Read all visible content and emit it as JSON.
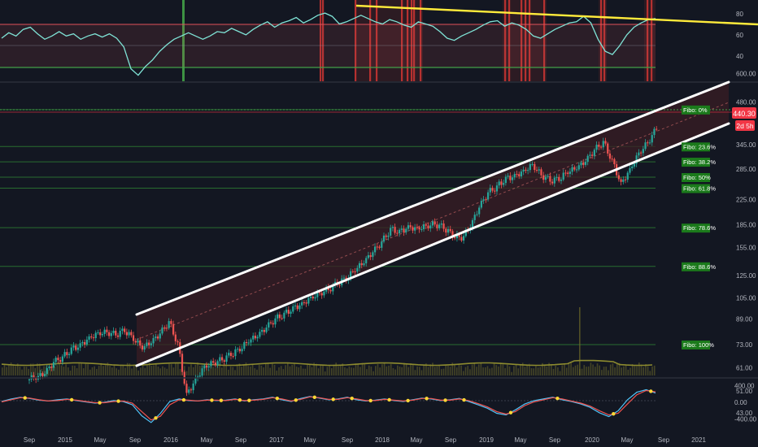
{
  "colors": {
    "background": "#131722",
    "axis_text": "#b2b5be",
    "grid": "#1f2330",
    "channel_line": "#ffffff",
    "channel_fill": "#3a1d24",
    "rsi_line": "#7fe3d6",
    "rsi_band": "#e0525a",
    "rsi_trendline": "#ffeb3b",
    "signal_red": "#e53935",
    "signal_green": "#43a047",
    "fibo_line": "#2e7d32",
    "fibo_label_bg": "#1b7a1b",
    "candle_up": "#26a69a",
    "candle_down": "#ef5350",
    "volume": "#6d6a2a",
    "macd_blue": "#4fc3f7",
    "macd_red": "#ef5350",
    "price_badge": "#f23645"
  },
  "chart_data": [
    {
      "type": "line",
      "panel": "rsi",
      "yticks": [
        "80",
        "60",
        "40"
      ],
      "ylim": [
        20,
        90
      ],
      "overbought": 70,
      "oversold": 30,
      "trendline_from": [
        "2017-09",
        88
      ],
      "trendline_to": [
        "2021-06",
        72
      ],
      "series": [
        {
          "values": [
            58,
            63,
            60,
            66,
            68,
            62,
            57,
            60,
            64,
            60,
            62,
            57,
            60,
            62,
            59,
            62,
            58,
            50,
            30,
            24,
            32,
            38,
            46,
            52,
            57,
            60,
            63,
            60,
            57,
            60,
            64,
            63,
            67,
            64,
            61,
            66,
            70,
            73,
            68,
            72,
            74,
            77,
            72,
            75,
            79,
            81,
            78,
            71,
            73,
            76,
            79,
            76,
            73,
            71,
            75,
            73,
            70,
            68,
            73,
            71,
            69,
            64,
            58,
            56,
            60,
            63,
            66,
            70,
            73,
            74,
            69,
            72,
            70,
            66,
            60,
            58,
            62,
            66,
            69,
            72,
            73,
            78,
            72,
            57,
            46,
            43,
            51,
            61,
            68,
            72,
            75,
            76
          ]
        }
      ]
    },
    {
      "type": "candlestick",
      "panel": "price",
      "yscale": "log",
      "ylim": [
        38,
        600
      ],
      "yticks": [
        "600.00",
        "480.00",
        "345.00",
        "285.00",
        "225.00",
        "185.00",
        "155.00",
        "125.00",
        "105.00",
        "89.00",
        "73.00",
        "61.00",
        "51.00",
        "43.00"
      ],
      "last_price": "440.30",
      "countdown": "2d 5h",
      "x": [
        "2014-09",
        "2014-10",
        "2014-11",
        "2014-12",
        "2015-01",
        "2015-02",
        "2015-03",
        "2015-04",
        "2015-05",
        "2015-06",
        "2015-07",
        "2015-08",
        "2015-09",
        "2015-10",
        "2015-11",
        "2015-12",
        "2016-01",
        "2016-02",
        "2016-03",
        "2016-04",
        "2016-05",
        "2016-06",
        "2016-07",
        "2016-08",
        "2016-09",
        "2016-10",
        "2016-11",
        "2016-12",
        "2017-01",
        "2017-02",
        "2017-03",
        "2017-04",
        "2017-05",
        "2017-06",
        "2017-07",
        "2017-08",
        "2017-09",
        "2017-10",
        "2017-11",
        "2017-12",
        "2018-01",
        "2018-02",
        "2018-03",
        "2018-04",
        "2018-05",
        "2018-06",
        "2018-07",
        "2018-08",
        "2018-09",
        "2018-10",
        "2018-11",
        "2018-12",
        "2019-01",
        "2019-02",
        "2019-03",
        "2019-04",
        "2019-05",
        "2019-06",
        "2019-07",
        "2019-08",
        "2019-09",
        "2019-10",
        "2019-11",
        "2019-12",
        "2020-01",
        "2020-02",
        "2020-03",
        "2020-04",
        "2020-05",
        "2020-06",
        "2020-07"
      ],
      "close": [
        57,
        59,
        64,
        66,
        70,
        72,
        76,
        79,
        80,
        79,
        82,
        77,
        72,
        75,
        80,
        87,
        73,
        49,
        55,
        61,
        63,
        65,
        68,
        71,
        76,
        79,
        84,
        89,
        92,
        96,
        99,
        104,
        108,
        112,
        118,
        123,
        132,
        140,
        151,
        162,
        178,
        174,
        180,
        178,
        182,
        186,
        182,
        172,
        168,
        185,
        214,
        238,
        248,
        263,
        268,
        278,
        293,
        272,
        262,
        266,
        282,
        291,
        306,
        332,
        351,
        302,
        252,
        281,
        320,
        349,
        392
      ],
      "fibonacci": [
        {
          "label": "Fibo:   0%",
          "value": 453
        },
        {
          "label": "Fibo: 23.6%",
          "value": 340
        },
        {
          "label": "Fibo: 38.2%",
          "value": 302
        },
        {
          "label": "Fibo:   50%",
          "value": 268
        },
        {
          "label": "Fibo: 61.8%",
          "value": 246
        },
        {
          "label": "Fibo: 78.6%",
          "value": 181
        },
        {
          "label": "Fibo: 88.6%",
          "value": 134
        },
        {
          "label": "Fibo: 100%",
          "value": 73
        }
      ],
      "channel": {
        "upper_from": [
          "2015-09",
          83
        ],
        "upper_to": [
          "2021-09",
          600
        ],
        "lower_from": [
          "2015-09",
          41
        ],
        "lower_to": [
          "2021-09",
          365
        ]
      }
    },
    {
      "type": "line",
      "panel": "oscillator",
      "yticks": [
        "400.00",
        "0.00",
        "-400.00"
      ],
      "ylim": [
        -560,
        560
      ],
      "series": [
        {
          "values": [
            20,
            80,
            120,
            90,
            50,
            30,
            60,
            80,
            40,
            10,
            -20,
            0,
            40,
            20,
            -60,
            -320,
            -480,
            -260,
            20,
            80,
            40,
            30,
            60,
            40,
            50,
            80,
            30,
            60,
            80,
            120,
            60,
            20,
            90,
            140,
            100,
            60,
            80,
            120,
            60,
            30,
            50,
            80,
            40,
            20,
            60,
            100,
            80,
            40,
            60,
            90,
            20,
            -60,
            -140,
            -260,
            -300,
            -180,
            -40,
            40,
            80,
            120,
            60,
            20,
            -40,
            -120,
            -250,
            -340,
            -200,
            60,
            240,
            300,
            220
          ]
        },
        {
          "values": [
            10,
            60,
            110,
            100,
            60,
            30,
            40,
            70,
            50,
            20,
            -10,
            -10,
            20,
            30,
            -20,
            -220,
            -420,
            -330,
            -60,
            60,
            50,
            30,
            50,
            50,
            40,
            70,
            40,
            50,
            70,
            110,
            80,
            30,
            70,
            130,
            110,
            70,
            70,
            110,
            80,
            40,
            40,
            70,
            50,
            30,
            50,
            90,
            90,
            50,
            50,
            80,
            40,
            -30,
            -110,
            -220,
            -280,
            -220,
            -80,
            10,
            60,
            110,
            80,
            30,
            -20,
            -90,
            -200,
            -300,
            -260,
            -40,
            180,
            280,
            250
          ]
        }
      ],
      "x_ticks": [
        "Sep",
        "2015",
        "May",
        "Sep",
        "2016",
        "May",
        "Sep",
        "2017",
        "May",
        "Sep",
        "2018",
        "May",
        "Sep",
        "2019",
        "May",
        "Sep",
        "2020",
        "May",
        "Sep",
        "2021"
      ]
    }
  ]
}
